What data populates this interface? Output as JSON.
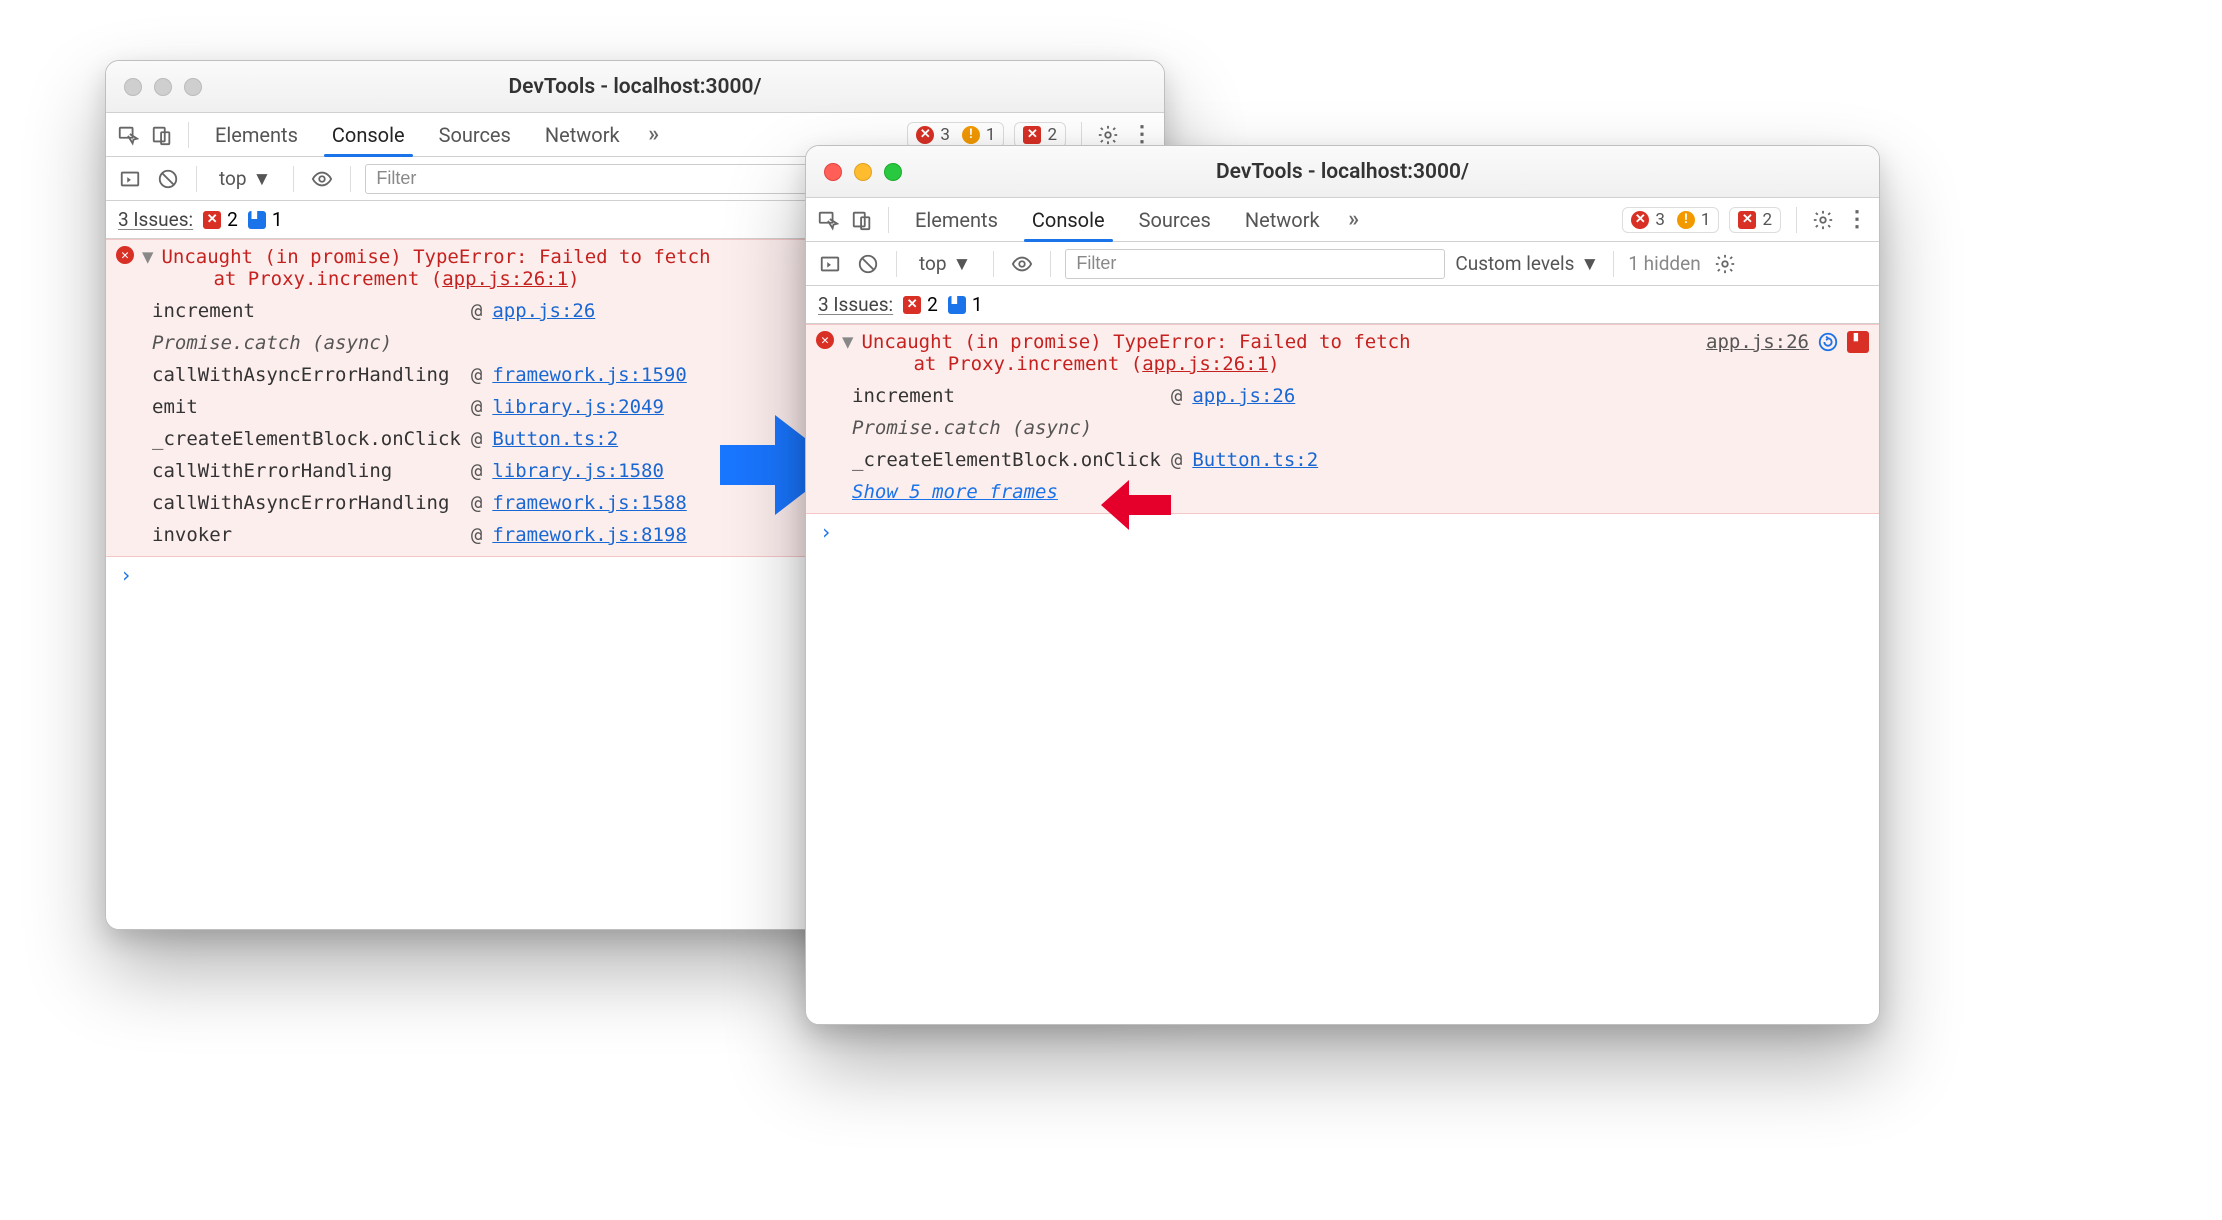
{
  "left": {
    "title": "DevTools - localhost:3000/",
    "tabs": [
      "Elements",
      "Console",
      "Sources",
      "Network"
    ],
    "active_tab": "Console",
    "badge_err": "3",
    "badge_warn": "1",
    "badge_overflow": "2",
    "context_label": "top",
    "filter_placeholder": "Filter",
    "issues_label": "3 Issues:",
    "issues_err": "2",
    "issues_info": "1",
    "error_line1": "Uncaught (in promise) TypeError: Failed to fetch",
    "error_line2_pre": "at Proxy.increment (",
    "error_line2_link": "app.js:26:1",
    "error_line2_post": ")",
    "frames": [
      {
        "fn": "increment",
        "at": "@",
        "src": "app.js:26"
      },
      {
        "async": "Promise.catch (async)"
      },
      {
        "fn": "callWithAsyncErrorHandling",
        "at": "@",
        "src": "framework.js:1590"
      },
      {
        "fn": "emit",
        "at": "@",
        "src": "library.js:2049"
      },
      {
        "fn": "_createElementBlock.onClick",
        "at": "@",
        "src": "Button.ts:2"
      },
      {
        "fn": "callWithErrorHandling",
        "at": "@",
        "src": "library.js:1580"
      },
      {
        "fn": "callWithAsyncErrorHandling",
        "at": "@",
        "src": "framework.js:1588"
      },
      {
        "fn": "invoker",
        "at": "@",
        "src": "framework.js:8198"
      }
    ]
  },
  "right": {
    "title": "DevTools - localhost:3000/",
    "tabs": [
      "Elements",
      "Console",
      "Sources",
      "Network"
    ],
    "active_tab": "Console",
    "badge_err": "3",
    "badge_warn": "1",
    "badge_overflow": "2",
    "context_label": "top",
    "filter_placeholder": "Filter",
    "levels_label": "Custom levels",
    "hidden_label": "1 hidden",
    "issues_label": "3 Issues:",
    "issues_err": "2",
    "issues_info": "1",
    "error_line1": "Uncaught (in promise) TypeError: Failed to fetch",
    "error_line2_pre": "at Proxy.increment (",
    "error_line2_link": "app.js:26:1",
    "error_line2_post": ")",
    "src_link": "app.js:26",
    "frames": [
      {
        "fn": "increment",
        "at": "@",
        "src": "app.js:26"
      },
      {
        "async": "Promise.catch (async)"
      },
      {
        "fn": "_createElementBlock.onClick",
        "at": "@",
        "src": "Button.ts:2"
      }
    ],
    "show_more": "Show 5 more frames"
  }
}
